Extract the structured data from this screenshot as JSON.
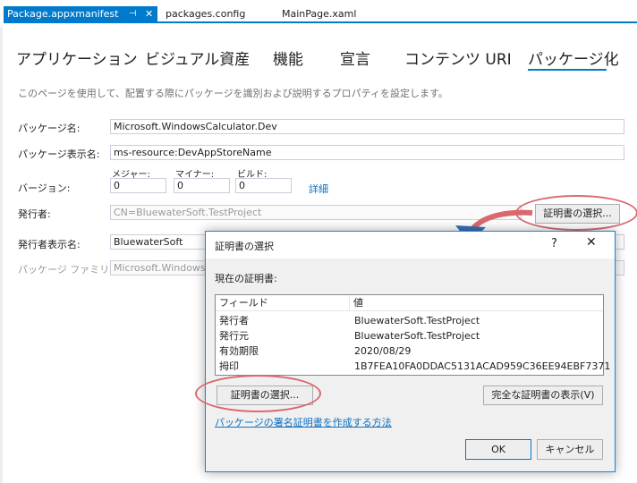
{
  "doc_tabs": [
    {
      "label": "Package.appxmanifest",
      "active": true
    },
    {
      "label": "packages.config",
      "active": false
    },
    {
      "label": "MainPage.xaml",
      "active": false
    }
  ],
  "doc_tab_icons": {
    "pin": "⊣",
    "close": "✕"
  },
  "manifest_tabs": [
    "アプリケーション",
    "ビジュアル資産",
    "機能",
    "宣言",
    "コンテンツ URI",
    "パッケージ化"
  ],
  "selected_tab": "パッケージ化",
  "description": "このページを使用して、配置する際にパッケージを識別および説明するプロパティを設定します。",
  "form": {
    "package_name_label": "パッケージ名:",
    "package_name": "Microsoft.WindowsCalculator.Dev",
    "display_name_label": "パッケージ表示名:",
    "display_name": "ms-resource:DevAppStoreName",
    "version_label": "バージョン:",
    "major_label": "メジャー:",
    "major": "0",
    "minor_label": "マイナー:",
    "minor": "0",
    "build_label": "ビルド:",
    "build": "0",
    "details_link": "詳細",
    "publisher_label": "発行者:",
    "publisher": "CN=BluewaterSoft.TestProject",
    "choose_cert_button": "証明書の選択...",
    "publisher_display_label": "発行者表示名:",
    "publisher_display": "BluewaterSoft",
    "family_label": "パッケージ ファミリ名:",
    "family": "Microsoft.WindowsCalcul"
  },
  "dialog": {
    "title": "証明書の選択",
    "help": "?",
    "close": "✕",
    "current_cert_label": "現在の証明書:",
    "columns": [
      "フィールド",
      "値"
    ],
    "rows": [
      {
        "field": "発行者",
        "value": "BluewaterSoft.TestProject"
      },
      {
        "field": "発行元",
        "value": "BluewaterSoft.TestProject"
      },
      {
        "field": "有効期限",
        "value": "2020/08/29"
      },
      {
        "field": "拇印",
        "value": "1B7FEA10FA0DDAC5131ACAD959C36EE94EBF7371"
      }
    ],
    "choose_cert_button": "証明書の選択...",
    "show_full_cert_button": "完全な証明書の表示(V)",
    "help_link": "パッケージの署名証明書を作成する方法",
    "ok_button": "OK",
    "cancel_button": "キャンセル"
  },
  "colors": {
    "accent": "#007acc",
    "highlight": "#d9696e",
    "dialog_border": "#1883d7"
  }
}
